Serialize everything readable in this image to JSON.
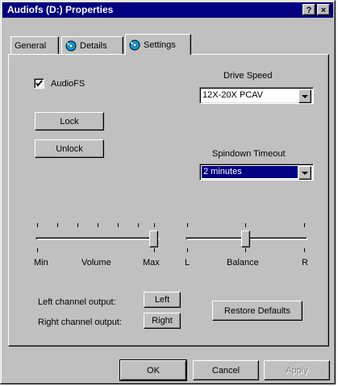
{
  "window": {
    "title": "Audiofs (D:) Properties",
    "help_label": "?",
    "close_label": "×"
  },
  "tabs": [
    {
      "label": "General"
    },
    {
      "label": "Details"
    },
    {
      "label": "Settings"
    }
  ],
  "settings": {
    "audiofs_label": "AudioFS",
    "audiofs_checked": true,
    "lock_label": "Lock",
    "unlock_label": "Unlock",
    "drive_speed": {
      "label": "Drive Speed",
      "value": "12X-20X PCAV"
    },
    "spindown": {
      "label": "Spindown Timeout",
      "value": "2 minutes"
    },
    "volume": {
      "min_label": "Min",
      "label": "Volume",
      "max_label": "Max",
      "value": 1.0
    },
    "balance": {
      "left_label": "L",
      "label": "Balance",
      "right_label": "R",
      "value": 0.5
    },
    "left_channel": {
      "label": "Left channel output:",
      "button": "Left"
    },
    "right_channel": {
      "label": "Right channel output:",
      "button": "Right"
    },
    "restore_label": "Restore Defaults"
  },
  "footer": {
    "ok_label": "OK",
    "cancel_label": "Cancel",
    "apply_label": "Apply"
  },
  "colors": {
    "titlebar": "#000080",
    "face": "#c0c0c0",
    "selection": "#000080"
  }
}
